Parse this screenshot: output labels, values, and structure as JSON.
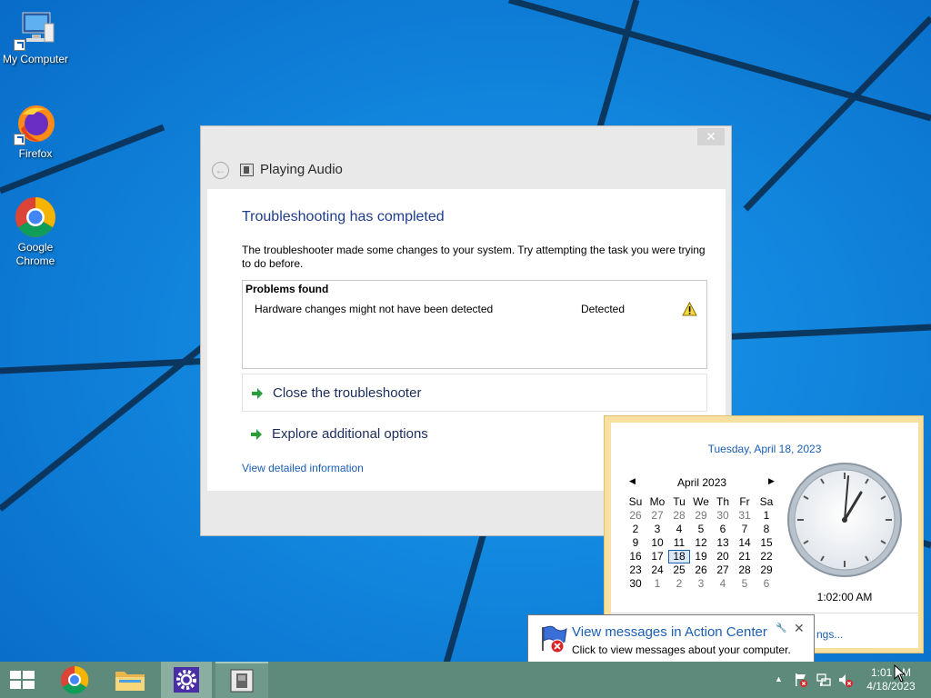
{
  "desktop": {
    "icons": [
      {
        "label": "My Computer",
        "icon": "computer-icon"
      },
      {
        "label": "Firefox",
        "icon": "firefox-icon"
      },
      {
        "label": "Google Chrome",
        "icon": "chrome-icon"
      }
    ]
  },
  "troubleshooter": {
    "title": "Playing Audio",
    "close_glyph": "✕",
    "back_glyph": "←",
    "heading": "Troubleshooting has completed",
    "description": "The troubleshooter made some changes to your system. Try attempting the task you were trying to do before.",
    "problems_header": "Problems found",
    "problems": [
      {
        "name": "Hardware changes might not have been detected",
        "status": "Detected",
        "icon": "warning-icon"
      }
    ],
    "options": [
      {
        "label": "Close the troubleshooter",
        "icon": "green-arrow-icon"
      },
      {
        "label": "Explore additional options",
        "icon": "green-arrow-icon"
      }
    ],
    "details_link": "View detailed information"
  },
  "calendar": {
    "long_date": "Tuesday, April 18, 2023",
    "month_label": "April 2023",
    "prev_glyph": "◀",
    "next_glyph": "▶",
    "weekdays": [
      "Su",
      "Mo",
      "Tu",
      "We",
      "Th",
      "Fr",
      "Sa"
    ],
    "weeks": [
      [
        "26",
        "27",
        "28",
        "29",
        "30",
        "31",
        "1"
      ],
      [
        "2",
        "3",
        "4",
        "5",
        "6",
        "7",
        "8"
      ],
      [
        "9",
        "10",
        "11",
        "12",
        "13",
        "14",
        "15"
      ],
      [
        "16",
        "17",
        "18",
        "19",
        "20",
        "21",
        "22"
      ],
      [
        "23",
        "24",
        "25",
        "26",
        "27",
        "28",
        "29"
      ],
      [
        "30",
        "1",
        "2",
        "3",
        "4",
        "5",
        "6"
      ]
    ],
    "today": "18",
    "clock_time": "1:02:00 AM",
    "settings_link": "ngs..."
  },
  "action_center_tip": {
    "title": "View messages in Action Center",
    "subtitle": "Click to view messages about your computer.",
    "close_glyph": "✕",
    "wrench_glyph": "🔧"
  },
  "taskbar": {
    "tray_arrow": "▲",
    "time": "1:01 AM",
    "date": "4/18/2023",
    "items": [
      "start-button",
      "chrome",
      "file-explorer",
      "settings",
      "troubleshooter"
    ]
  },
  "colors": {
    "wallpaper": "#0a78d7",
    "taskbar": "#5d8a7a",
    "link": "#1a5fb4",
    "heading": "#1e3d8c",
    "calendar_border": "#f8e0a0"
  }
}
